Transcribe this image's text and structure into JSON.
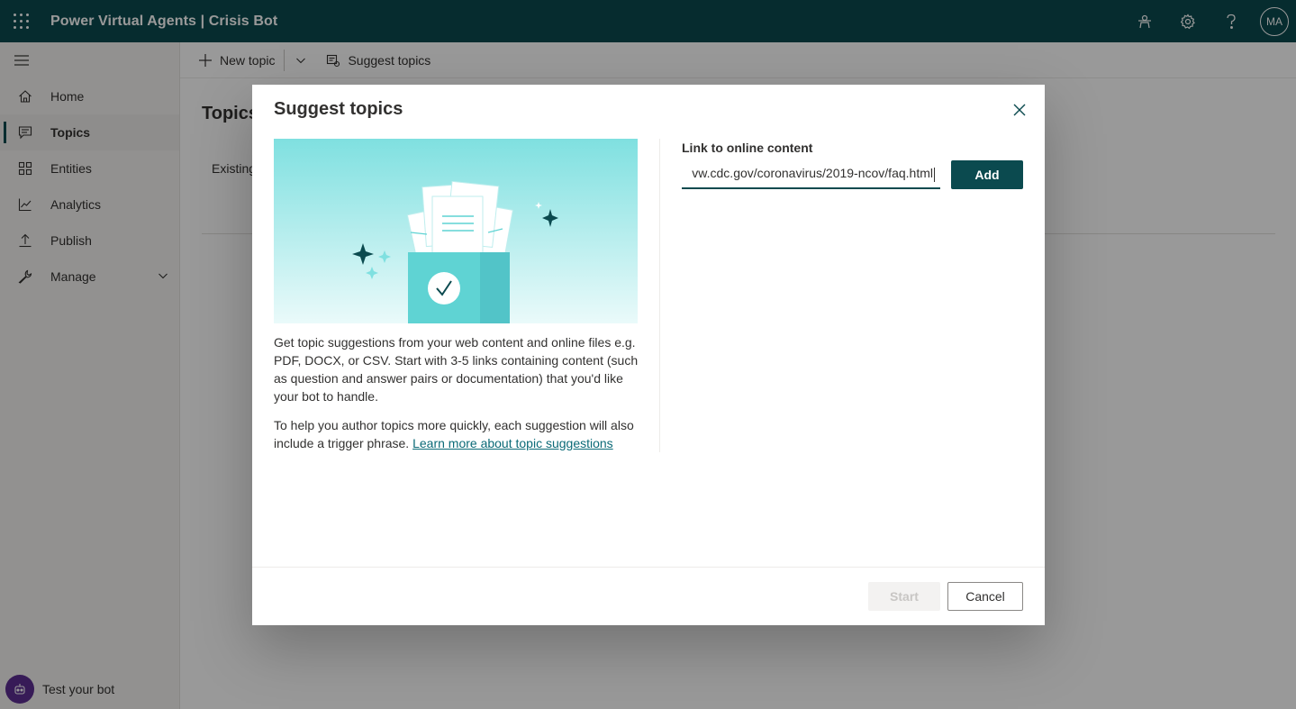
{
  "header": {
    "app_title": "Power Virtual Agents | Crisis Bot",
    "avatar_initials": "MA"
  },
  "command_bar": {
    "new_topic_label": "New topic",
    "suggest_topics_label": "Suggest topics"
  },
  "sidebar": {
    "items": [
      {
        "label": "Home",
        "icon": "home-icon"
      },
      {
        "label": "Topics",
        "icon": "chat-icon",
        "active": true
      },
      {
        "label": "Entities",
        "icon": "entities-icon"
      },
      {
        "label": "Analytics",
        "icon": "analytics-icon"
      },
      {
        "label": "Publish",
        "icon": "upload-icon"
      },
      {
        "label": "Manage",
        "icon": "wrench-icon",
        "expandable": true
      }
    ],
    "test_bot_label": "Test your bot"
  },
  "page": {
    "title": "Topics",
    "tab_existing": "Existing"
  },
  "dialog": {
    "title": "Suggest topics",
    "description_1": "Get topic suggestions from your web content and online files e.g. PDF, DOCX, or CSV. Start with 3-5 links containing content (such as question and answer pairs or documentation) that you'd like your bot to handle.",
    "description_2": "To help you author topics more quickly, each suggestion will also include a trigger phrase.",
    "learn_more_link": "Learn more about topic suggestions",
    "link_label": "Link to online content",
    "link_value": "vw.cdc.gov/coronavirus/2019-ncov/faq.html",
    "add_label": "Add",
    "start_label": "Start",
    "cancel_label": "Cancel"
  },
  "colors": {
    "brand": "#0b4a4f",
    "link": "#0b6a77",
    "illustration_teal": "#5fd3d3"
  }
}
